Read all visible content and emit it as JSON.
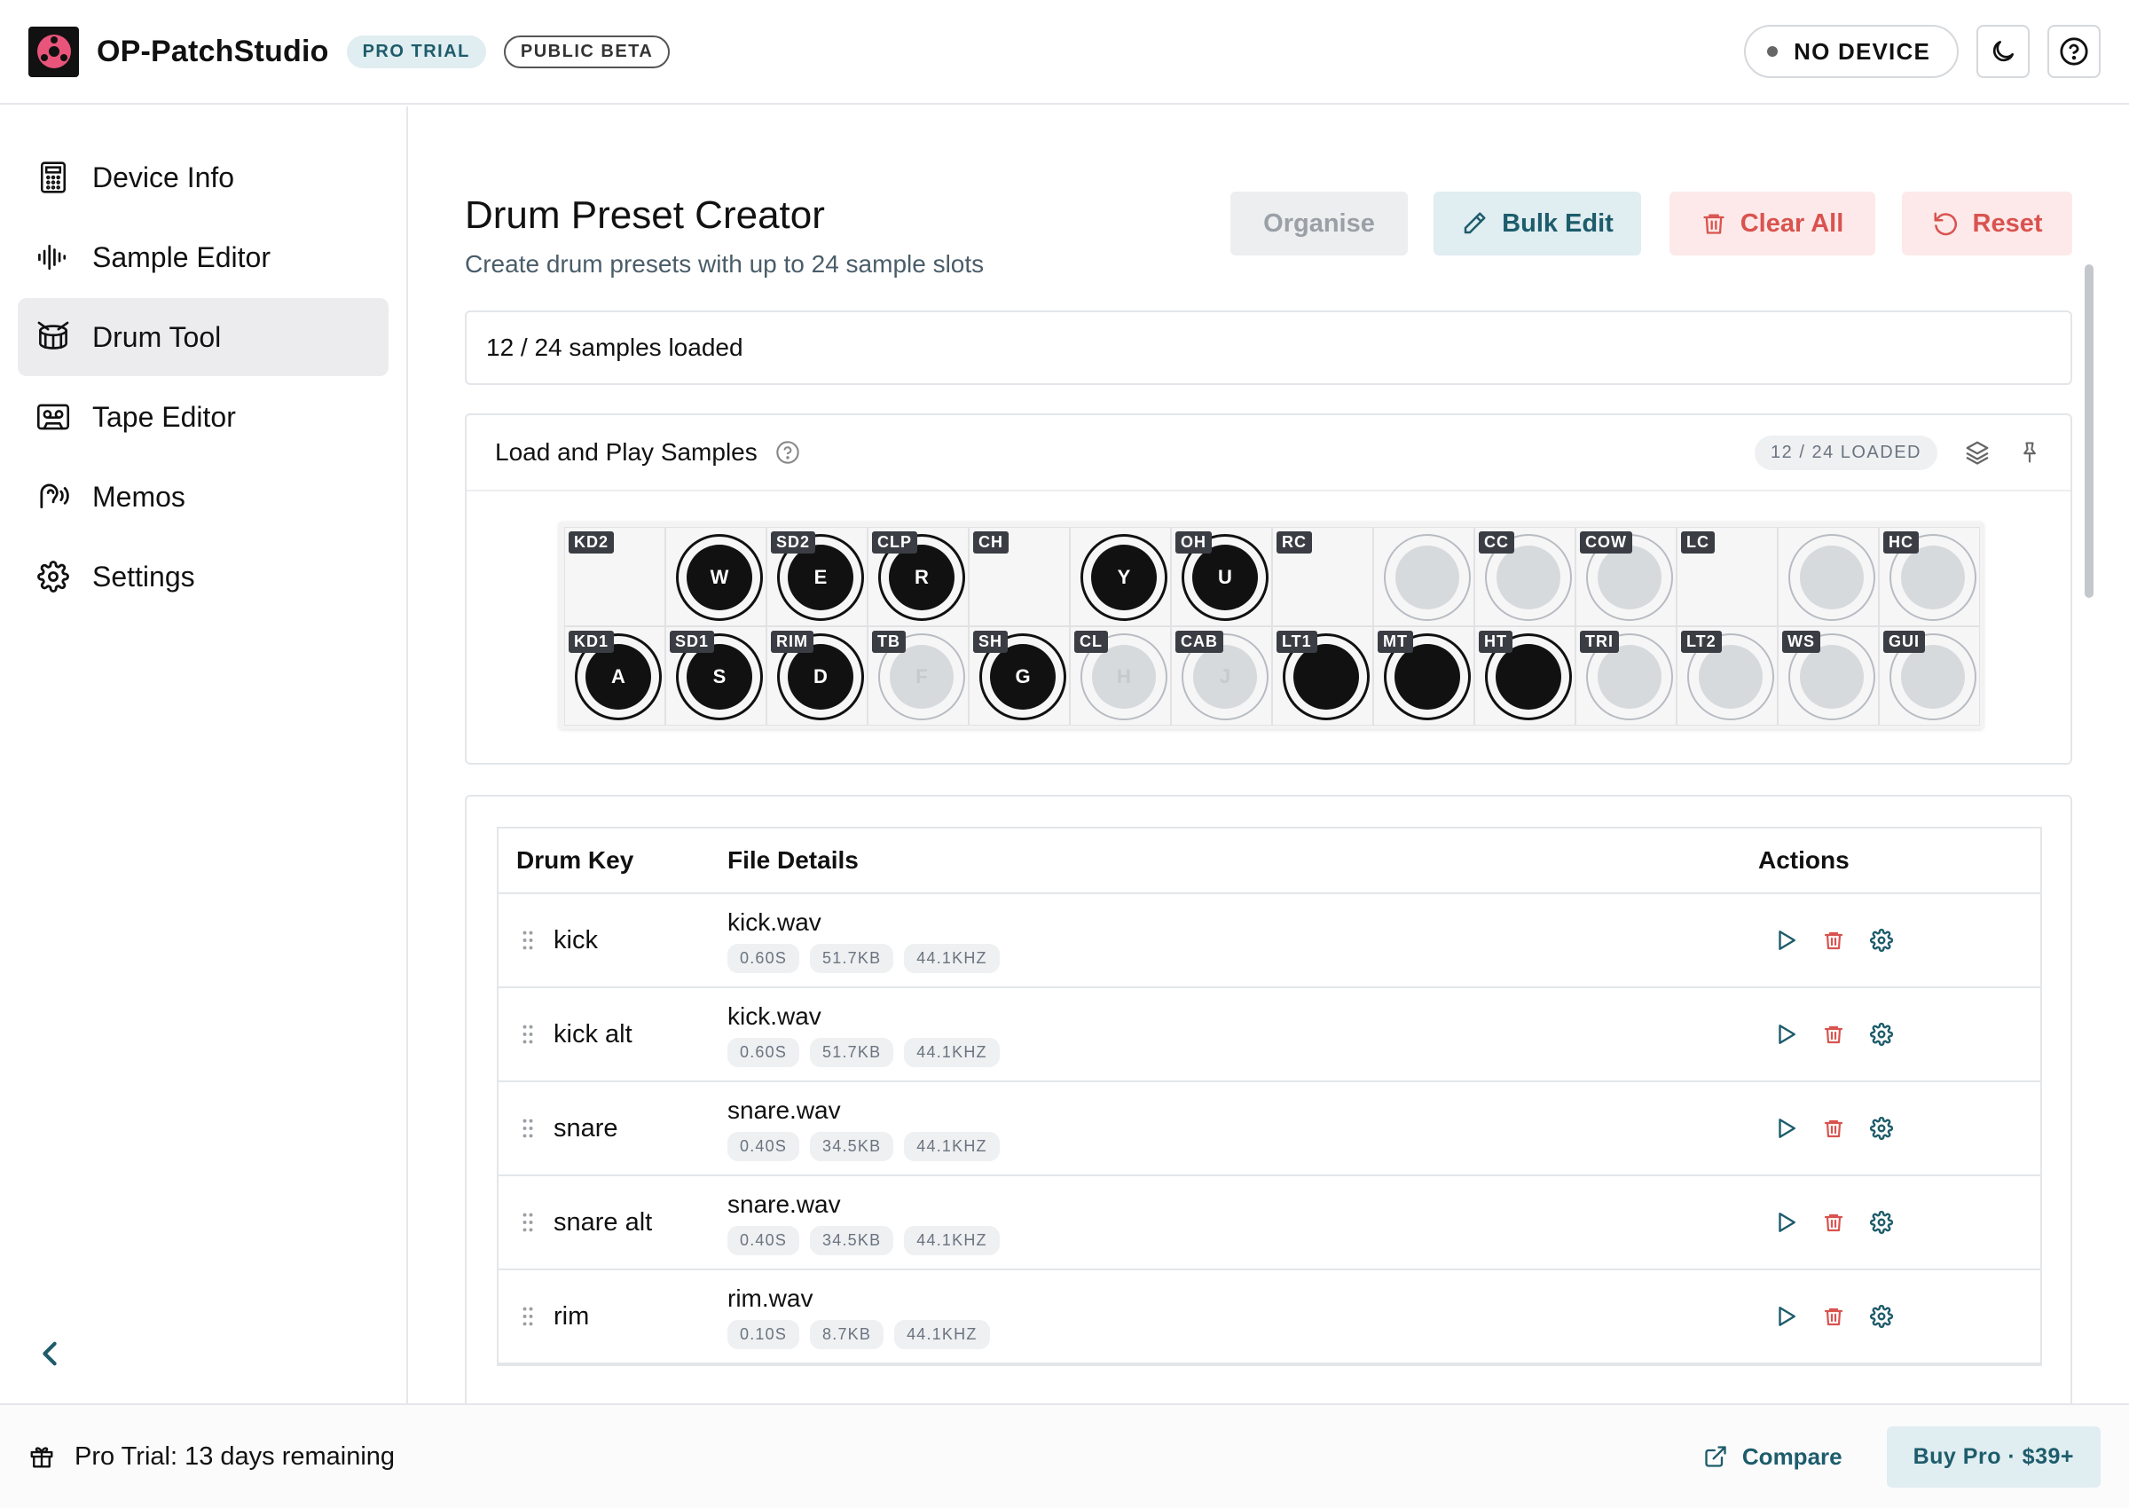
{
  "app": {
    "title": "OP-PatchStudio",
    "badge_pro": "PRO TRIAL",
    "badge_beta": "PUBLIC BETA",
    "device_status": "NO DEVICE",
    "accent": "#1d5c6b",
    "danger": "#d9534f",
    "logo_color": "#e8547a"
  },
  "sidebar": {
    "items": [
      {
        "label": "Device Info",
        "icon": "calculator-icon"
      },
      {
        "label": "Sample Editor",
        "icon": "waveform-icon"
      },
      {
        "label": "Drum Tool",
        "icon": "drum-icon",
        "active": true
      },
      {
        "label": "Tape Editor",
        "icon": "cassette-icon"
      },
      {
        "label": "Memos",
        "icon": "ear-icon"
      },
      {
        "label": "Settings",
        "icon": "gear-icon"
      }
    ]
  },
  "main": {
    "title": "Drum Preset Creator",
    "subtitle": "Create drum presets with up to 24 sample slots",
    "buttons": {
      "organise": "Organise",
      "bulk_edit": "Bulk Edit",
      "clear_all": "Clear All",
      "reset": "Reset"
    },
    "status": "12 / 24 samples loaded",
    "load_section": {
      "title": "Load and Play Samples",
      "loaded_badge": "12 / 24 LOADED"
    }
  },
  "pads": {
    "row1": [
      {
        "label": "KD2",
        "key": "",
        "loaded": false,
        "circle": false
      },
      {
        "label": "",
        "key": "W",
        "loaded": true
      },
      {
        "label": "SD2",
        "key": "E",
        "loaded": true
      },
      {
        "label": "CLP",
        "key": "R",
        "loaded": true
      },
      {
        "label": "CH",
        "key": "",
        "loaded": false,
        "circle": false
      },
      {
        "label": "",
        "key": "Y",
        "loaded": true
      },
      {
        "label": "OH",
        "key": "U",
        "loaded": true
      },
      {
        "label": "RC",
        "key": "",
        "loaded": false,
        "circle": false
      },
      {
        "label": "",
        "key": "",
        "loaded": false
      },
      {
        "label": "CC",
        "key": "",
        "loaded": false
      },
      {
        "label": "COW",
        "key": "",
        "loaded": false
      },
      {
        "label": "LC",
        "key": "",
        "loaded": false,
        "circle": false
      },
      {
        "label": "",
        "key": "",
        "loaded": false
      },
      {
        "label": "HC",
        "key": "",
        "loaded": false
      }
    ],
    "row2": [
      {
        "label": "KD1",
        "key": "A",
        "loaded": true
      },
      {
        "label": "SD1",
        "key": "S",
        "loaded": true
      },
      {
        "label": "RIM",
        "key": "D",
        "loaded": true
      },
      {
        "label": "TB",
        "key": "F",
        "loaded": false
      },
      {
        "label": "SH",
        "key": "G",
        "loaded": true
      },
      {
        "label": "CL",
        "key": "H",
        "loaded": false
      },
      {
        "label": "CAB",
        "key": "J",
        "loaded": false
      },
      {
        "label": "LT1",
        "key": "",
        "loaded": true
      },
      {
        "label": "MT",
        "key": "",
        "loaded": true
      },
      {
        "label": "HT",
        "key": "",
        "loaded": true
      },
      {
        "label": "TRI",
        "key": "",
        "loaded": false
      },
      {
        "label": "LT2",
        "key": "",
        "loaded": false
      },
      {
        "label": "WS",
        "key": "",
        "loaded": false
      },
      {
        "label": "GUI",
        "key": "",
        "loaded": false
      }
    ]
  },
  "table": {
    "headers": {
      "key": "Drum Key",
      "file": "File Details",
      "actions": "Actions"
    },
    "rows": [
      {
        "key": "kick",
        "file": "kick.wav",
        "duration": "0.60S",
        "size": "51.7KB",
        "rate": "44.1KHZ"
      },
      {
        "key": "kick alt",
        "file": "kick.wav",
        "duration": "0.60S",
        "size": "51.7KB",
        "rate": "44.1KHZ"
      },
      {
        "key": "snare",
        "file": "snare.wav",
        "duration": "0.40S",
        "size": "34.5KB",
        "rate": "44.1KHZ"
      },
      {
        "key": "snare alt",
        "file": "snare.wav",
        "duration": "0.40S",
        "size": "34.5KB",
        "rate": "44.1KHZ"
      },
      {
        "key": "rim",
        "file": "rim.wav",
        "duration": "0.10S",
        "size": "8.7KB",
        "rate": "44.1KHZ"
      }
    ]
  },
  "footer": {
    "trial_text": "Pro Trial: 13 days remaining",
    "compare": "Compare",
    "buy": "Buy Pro · $39+"
  }
}
